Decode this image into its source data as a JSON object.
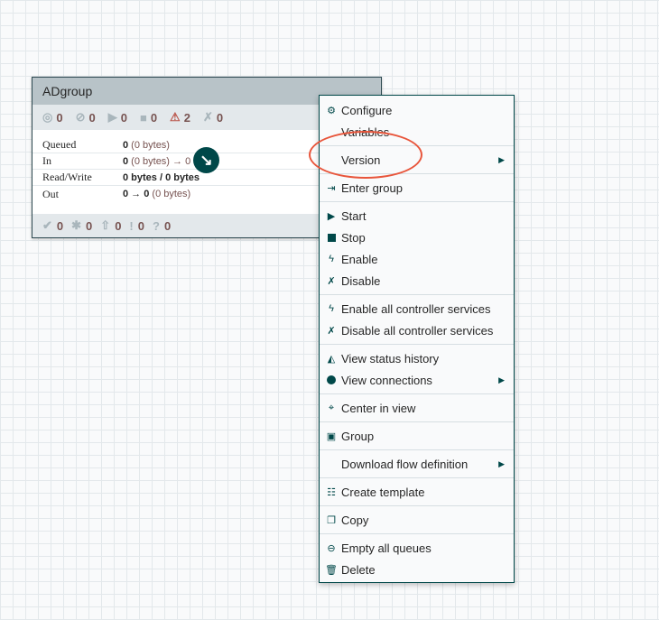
{
  "process_group": {
    "title": "ADgroup",
    "stats": [
      {
        "icon": "transmitting-icon",
        "glyph": "◎",
        "value": "0"
      },
      {
        "icon": "not-transmitting-icon",
        "glyph": "⊘",
        "value": "0"
      },
      {
        "icon": "running-icon",
        "glyph": "▶",
        "value": "0"
      },
      {
        "icon": "stopped-icon",
        "glyph": "■",
        "value": "0"
      },
      {
        "icon": "invalid-warning-icon",
        "glyph": "⚠",
        "value": "2"
      },
      {
        "icon": "disabled-icon",
        "glyph": "✗",
        "value": "0"
      }
    ],
    "rows": [
      {
        "label": "Queued",
        "value_bold": "0",
        "value_rest": " (0 bytes)"
      },
      {
        "label": "In",
        "value_bold": "0",
        "value_rest": " (0 bytes) → 0"
      },
      {
        "label": "Read/Write",
        "value_bold": "0 bytes / 0 bytes",
        "value_rest": ""
      },
      {
        "label": "Out",
        "value_bold": "0 → 0",
        "value_rest": " (0 bytes)"
      }
    ],
    "footer": [
      {
        "icon": "up-to-date-icon",
        "glyph": "✔",
        "value": "0"
      },
      {
        "icon": "locally-modified-icon",
        "glyph": "✱",
        "value": "0"
      },
      {
        "icon": "stale-icon",
        "glyph": "⇧",
        "value": "0"
      },
      {
        "icon": "sync-failure-icon",
        "glyph": "!",
        "value": "0"
      },
      {
        "icon": "unknown-icon",
        "glyph": "?",
        "value": "0"
      }
    ]
  },
  "context_menu": {
    "configure": "Configure",
    "variables": "Variables",
    "version": "Version",
    "enter_group": "Enter group",
    "start": "Start",
    "stop": "Stop",
    "enable": "Enable",
    "disable": "Disable",
    "enable_all_cs": "Enable all controller services",
    "disable_all_cs": "Disable all controller services",
    "view_status_history": "View status history",
    "view_connections": "View connections",
    "center_in_view": "Center in view",
    "group": "Group",
    "download_flow_definition": "Download flow definition",
    "create_template": "Create template",
    "copy": "Copy",
    "empty_all_queues": "Empty all queues",
    "delete": "Delete"
  },
  "colors": {
    "accent": "#004849",
    "highlight_ring": "#e8553b",
    "warning": "#ba554a"
  }
}
